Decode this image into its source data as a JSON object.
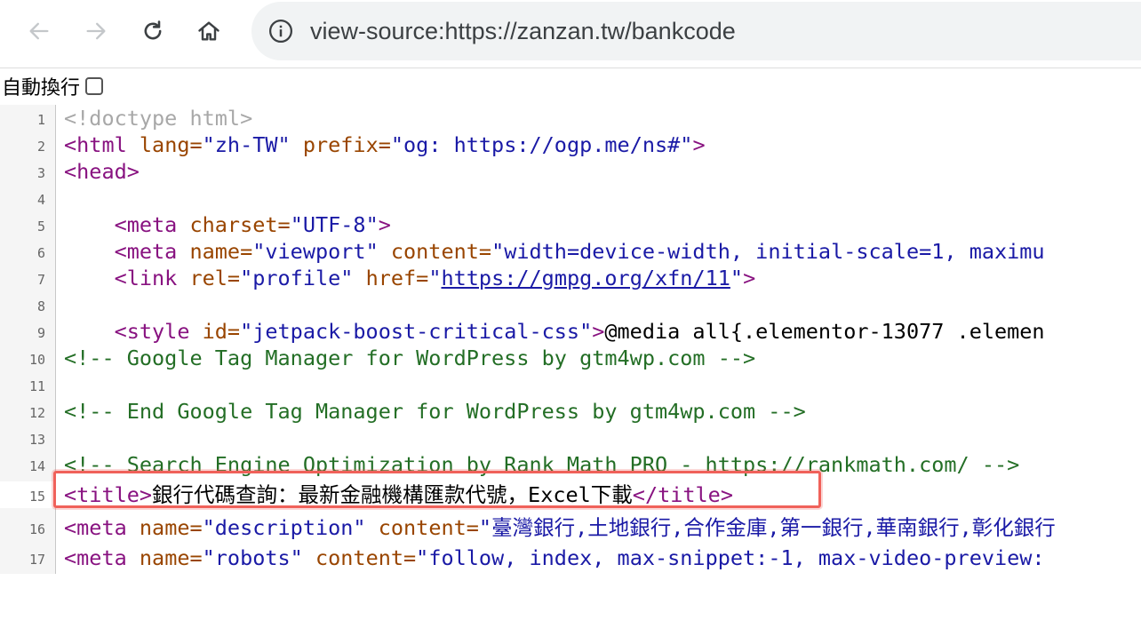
{
  "toolbar": {
    "url": "view-source:https://zanzan.tw/bankcode"
  },
  "wrap_label": "自動換行",
  "lines": [
    {
      "n": "1"
    },
    {
      "n": "2"
    },
    {
      "n": "3"
    },
    {
      "n": "4"
    },
    {
      "n": "5"
    },
    {
      "n": "6"
    },
    {
      "n": "7"
    },
    {
      "n": "8"
    },
    {
      "n": "9"
    },
    {
      "n": "10"
    },
    {
      "n": "11"
    },
    {
      "n": "12"
    },
    {
      "n": "13"
    },
    {
      "n": "14"
    },
    {
      "n": "15"
    },
    {
      "n": "16"
    },
    {
      "n": "17"
    }
  ],
  "src": {
    "l1": "<!doctype html>",
    "l2_open": "<html",
    "l2_attr1": " lang=",
    "l2_val1": "\"zh-TW\"",
    "l2_attr2": " prefix=",
    "l2_val2": "\"og: https://ogp.me/ns#\"",
    "l2_close": ">",
    "l3": "<head>",
    "l5_open": "    <meta",
    "l5_attr": " charset=",
    "l5_val": "\"UTF-8\"",
    "l5_close": ">",
    "l6_open": "    <meta",
    "l6_attr1": " name=",
    "l6_val1": "\"viewport\"",
    "l6_attr2": " content=",
    "l6_val2": "\"width=device-width, initial-scale=1, maximu",
    "l7_open": "    <link",
    "l7_attr1": " rel=",
    "l7_val1": "\"profile\"",
    "l7_attr2": " href=",
    "l7_q1": "\"",
    "l7_link": "https://gmpg.org/xfn/11",
    "l7_q2": "\"",
    "l7_close": ">",
    "l9_open": "    <style",
    "l9_attr": " id=",
    "l9_val": "\"jetpack-boost-critical-css\"",
    "l9_close": ">",
    "l9_text": "@media all{.elementor-13077 .elemen",
    "l10": "<!-- Google Tag Manager for WordPress by gtm4wp.com -->",
    "l12": "<!-- End Google Tag Manager for WordPress by gtm4wp.com -->",
    "l14": "<!-- Search Engine Optimization by Rank Math PRO - https://rankmath.com/ -->",
    "l15_open": "<title>",
    "l15_text": "銀行代碼查詢：最新金融機構匯款代號，Excel下載",
    "l15_close": "</title>",
    "l16_open": "<meta",
    "l16_attr1": " name=",
    "l16_val1": "\"description\"",
    "l16_attr2": " content=",
    "l16_val2": "\"臺灣銀行,土地銀行,合作金庫,第一銀行,華南銀行,彰化銀行",
    "l17_open": "<meta",
    "l17_attr1": " name=",
    "l17_val1": "\"robots\"",
    "l17_attr2": " content=",
    "l17_val2": "\"follow, index, max-snippet:-1, max-video-preview:"
  }
}
